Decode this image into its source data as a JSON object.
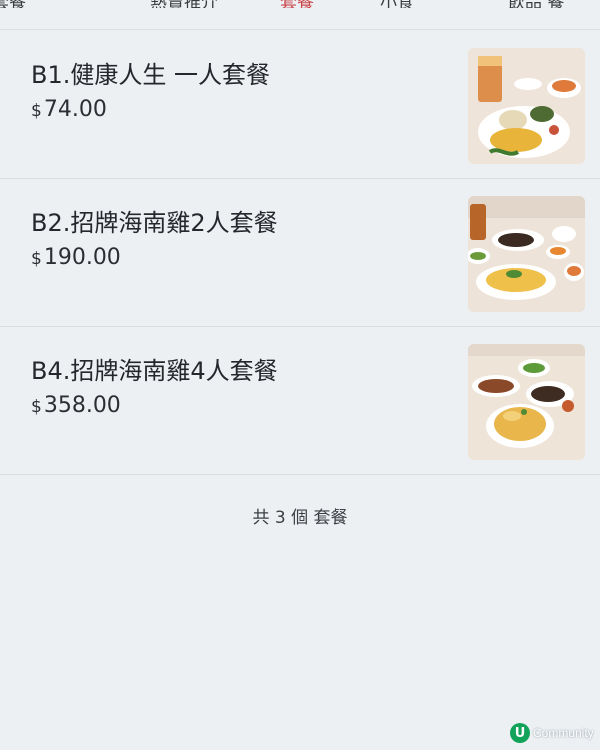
{
  "tabs": [
    {
      "label": "套餐",
      "active": false
    },
    {
      "label": "熱賣推介",
      "active": false
    },
    {
      "label": "套餐",
      "active": true
    },
    {
      "label": "小食",
      "active": false
    },
    {
      "label": "飲品 餐",
      "active": false
    }
  ],
  "items": [
    {
      "name": "B1.健康人生 一人套餐",
      "currency": "$",
      "price": "74.00",
      "image": "hainan-chicken-single-set-photo"
    },
    {
      "name": "B2.招牌海南雞2人套餐",
      "currency": "$",
      "price": "190.00",
      "image": "hainan-chicken-2-person-set-photo"
    },
    {
      "name": "B4.招牌海南雞4人套餐",
      "currency": "$",
      "price": "358.00",
      "image": "hainan-chicken-4-person-set-photo"
    }
  ],
  "summary": {
    "count_text": "共 3 個 套餐"
  },
  "watermark": {
    "logo": "U",
    "text": "Community"
  },
  "colors": {
    "background": "#edf0f3",
    "active_tab": "#c9474b",
    "watermark_green": "#12a35a"
  }
}
